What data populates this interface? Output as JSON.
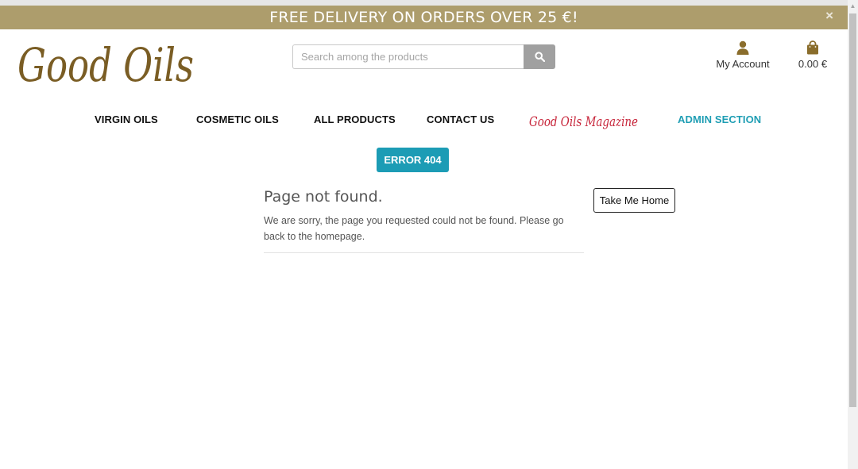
{
  "banner": {
    "text": "FREE DELIVERY ON ORDERS OVER 25 €!",
    "close_glyph": "×",
    "background": "#ad9d6c"
  },
  "logo": {
    "text": "Good Oils",
    "color": "#7a5d24"
  },
  "search": {
    "placeholder": "Search among the products",
    "button_icon": "search-icon"
  },
  "header": {
    "account_label": "My Account",
    "account_icon": "user-icon",
    "cart_total": "0.00 €",
    "cart_icon": "shopping-bag-icon",
    "icon_color": "#8a6d2c"
  },
  "nav": {
    "virgin_oils": "VIRGIN OILS",
    "cosmetic_oils": "COSMETIC OILS",
    "all_products": "ALL PRODUCTS",
    "contact_us": "CONTACT US",
    "magazine": "Good Oils Magazine",
    "magazine_color": "#c7253a",
    "admin_section": "ADMIN SECTION",
    "admin_color": "#1f9eb4"
  },
  "error": {
    "badge": "ERROR 404",
    "badge_color": "#1c9cb5",
    "title": "Page not found.",
    "message": "We are sorry, the page you requested could not be found. Please go back to the homepage.",
    "home_button": "Take Me Home"
  }
}
